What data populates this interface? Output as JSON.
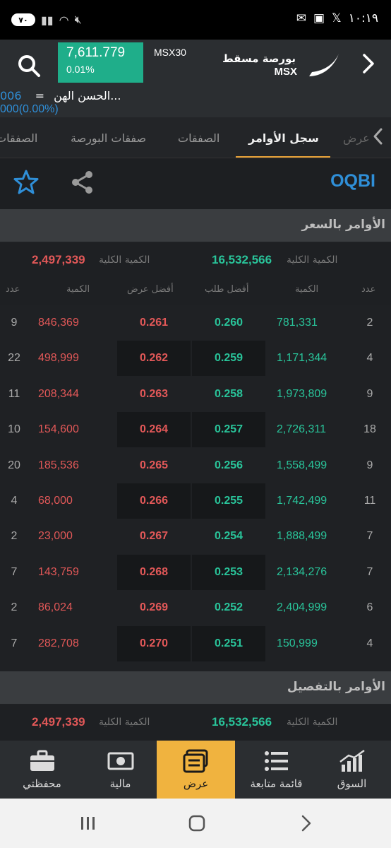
{
  "status": {
    "battery": "٧٠",
    "time": "١٠:١٩"
  },
  "header": {
    "index_value": "7,611.779",
    "index_change": "0.01%",
    "index_name": "MSX30",
    "brand_ar": "بورصة مسقط",
    "brand_en": "MSX",
    "ticker_name": "الحسن الهن...",
    "ticker_eq": "=",
    "ticker_price": "006",
    "ticker_change": "000(0.00%)"
  },
  "tabs": [
    "عرض",
    "سجل الأوامر",
    "الصفقات",
    "صفقات البورصة",
    "الصفقات"
  ],
  "symbol": "OQBI",
  "orders_by_price": {
    "title": "الأوامر بالسعر",
    "total_label": "الكمية الكلية",
    "bid_total": "16,532,566",
    "ask_total": "2,497,339",
    "columns": {
      "count": "عدد",
      "qty": "الكمية",
      "best_bid": "أفضل طلب",
      "best_ask": "أفضل عرض"
    },
    "rows": [
      {
        "ask_count": "9",
        "ask_qty": "846,369",
        "ask_price": "0.261",
        "bid_price": "0.260",
        "bid_qty": "781,331",
        "bid_count": "2"
      },
      {
        "ask_count": "22",
        "ask_qty": "498,999",
        "ask_price": "0.262",
        "bid_price": "0.259",
        "bid_qty": "1,171,344",
        "bid_count": "4"
      },
      {
        "ask_count": "11",
        "ask_qty": "208,344",
        "ask_price": "0.263",
        "bid_price": "0.258",
        "bid_qty": "1,973,809",
        "bid_count": "9"
      },
      {
        "ask_count": "10",
        "ask_qty": "154,600",
        "ask_price": "0.264",
        "bid_price": "0.257",
        "bid_qty": "2,726,311",
        "bid_count": "18"
      },
      {
        "ask_count": "20",
        "ask_qty": "185,536",
        "ask_price": "0.265",
        "bid_price": "0.256",
        "bid_qty": "1,558,499",
        "bid_count": "9"
      },
      {
        "ask_count": "4",
        "ask_qty": "68,000",
        "ask_price": "0.266",
        "bid_price": "0.255",
        "bid_qty": "1,742,499",
        "bid_count": "11"
      },
      {
        "ask_count": "2",
        "ask_qty": "23,000",
        "ask_price": "0.267",
        "bid_price": "0.254",
        "bid_qty": "1,888,499",
        "bid_count": "7"
      },
      {
        "ask_count": "7",
        "ask_qty": "143,759",
        "ask_price": "0.268",
        "bid_price": "0.253",
        "bid_qty": "2,134,276",
        "bid_count": "7"
      },
      {
        "ask_count": "2",
        "ask_qty": "86,024",
        "ask_price": "0.269",
        "bid_price": "0.252",
        "bid_qty": "2,404,999",
        "bid_count": "6"
      },
      {
        "ask_count": "7",
        "ask_qty": "282,708",
        "ask_price": "0.270",
        "bid_price": "0.251",
        "bid_qty": "150,999",
        "bid_count": "4"
      }
    ]
  },
  "orders_detail": {
    "title": "الأوامر بالتفصيل",
    "total_label": "الكمية الكلية",
    "bid_total": "16,532,566",
    "ask_total": "2,497,339"
  },
  "bottom_nav": [
    "محفظتي",
    "مالية",
    "عرض",
    "قائمة متابعة",
    "السوق"
  ],
  "colors": {
    "accent": "#f0b33f",
    "green": "#29c49a",
    "red": "#e25858",
    "blue": "#2f8fd8"
  }
}
